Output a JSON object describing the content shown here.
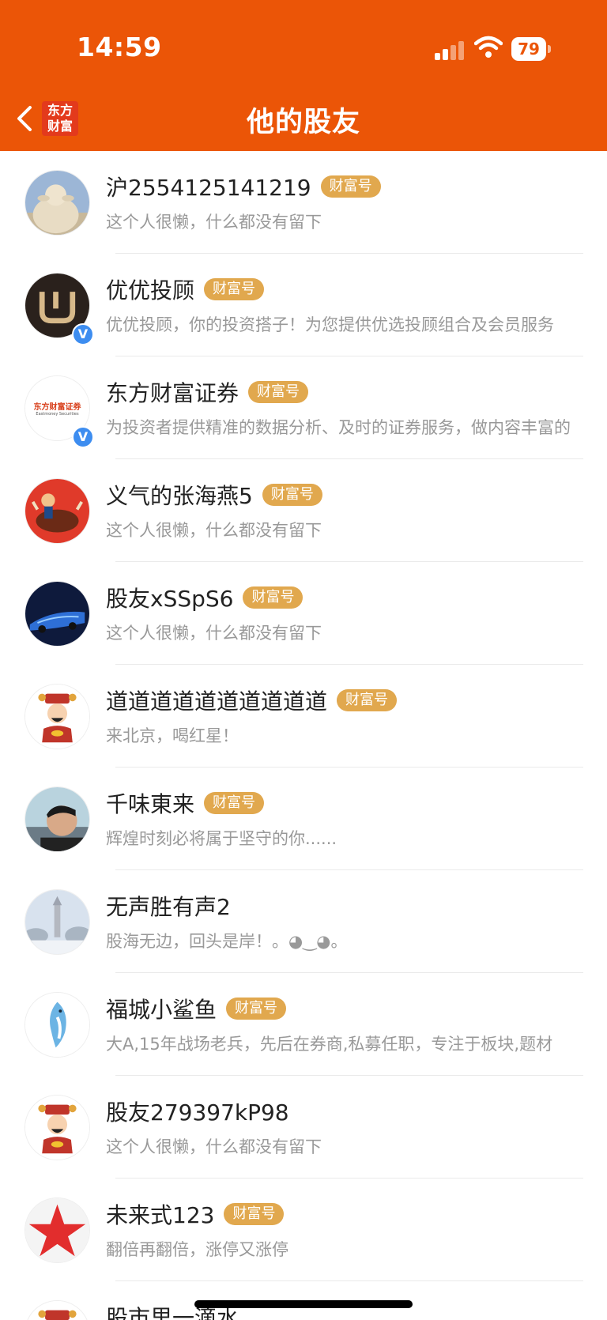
{
  "status": {
    "time": "14:59",
    "battery": "79"
  },
  "header": {
    "title": "他的股友",
    "logo_line1": "东方",
    "logo_line2": "财富"
  },
  "badge_label": "财富号",
  "users": [
    {
      "name": "沪2554125141219",
      "desc": "这个人很懒，什么都没有留下",
      "badge": true,
      "verified": false,
      "avatar": "buddha-statue"
    },
    {
      "name": "优优投顾",
      "desc": "优优投顾，你的投资搭子！为您提供优选投顾组合及会员服务",
      "badge": true,
      "verified": true,
      "avatar": "uu-logo"
    },
    {
      "name": "东方财富证券",
      "desc": "为投资者提供精准的数据分析、及时的证券服务，做内容丰富的",
      "badge": true,
      "verified": true,
      "avatar": "eastmoney-securities-logo",
      "avatar_text": "东方财富证券",
      "avatar_subtext": "Eastmoney Securities"
    },
    {
      "name": "义气的张海燕5",
      "desc": "这个人很懒，什么都没有留下",
      "badge": true,
      "verified": false,
      "avatar": "bull-rider"
    },
    {
      "name": "股友xSSpS6",
      "desc": "这个人很懒，什么都没有留下",
      "badge": true,
      "verified": false,
      "avatar": "car"
    },
    {
      "name": "道道道道道道道道道道",
      "desc": "来北京，喝红星！",
      "badge": true,
      "verified": false,
      "avatar": "fortune-god"
    },
    {
      "name": "千味東来",
      "desc": "辉煌时刻必将属于坚守的你......",
      "badge": true,
      "verified": false,
      "avatar": "portrait"
    },
    {
      "name": "无声胜有声2",
      "desc": "股海无边，回头是岸！。◕‿◕。",
      "badge": false,
      "verified": false,
      "avatar": "snow-tower"
    },
    {
      "name": "福城小鲨鱼",
      "desc": "大A,15年战场老兵，先后在券商,私募任职，专注于板块,题材",
      "badge": true,
      "verified": false,
      "avatar": "shark"
    },
    {
      "name": "股友279397kP98",
      "desc": "这个人很懒，什么都没有留下",
      "badge": false,
      "verified": false,
      "avatar": "fortune-god"
    },
    {
      "name": "未来式123",
      "desc": "翻倍再翻倍，涨停又涨停",
      "badge": true,
      "verified": false,
      "avatar": "red-star"
    },
    {
      "name": "股市里一滴水",
      "desc": "",
      "badge": false,
      "verified": false,
      "avatar": "fortune-god"
    }
  ],
  "colors": {
    "header_bg": "#EB5507",
    "badge_bg": "#E1A84E",
    "verified": "#3D8DF0"
  }
}
